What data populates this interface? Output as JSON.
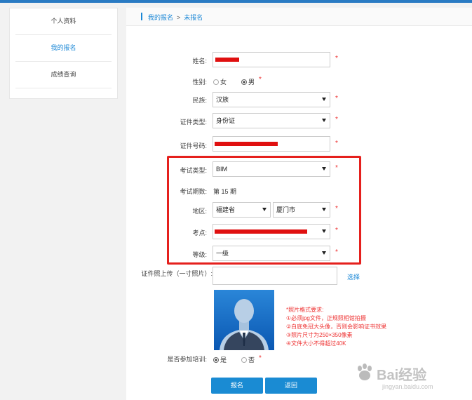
{
  "sidebar": {
    "items": [
      {
        "label": "个人资料"
      },
      {
        "label": "我的报名"
      },
      {
        "label": "成绩查询"
      }
    ]
  },
  "breadcrumb": {
    "parent": "我的报名",
    "separator": ">",
    "current": "未报名"
  },
  "form": {
    "name_label": "姓名:",
    "gender_label": "性别:",
    "gender_female": "女",
    "gender_male": "男",
    "ethnicity_label": "民族:",
    "ethnicity_value": "汉族",
    "id_type_label": "证件类型:",
    "id_type_value": "身份证",
    "id_number_label": "证件号码:",
    "exam_type_label": "考试类型:",
    "exam_type_value": "BIM",
    "exam_period_label": "考试期数:",
    "exam_period_value": "第 15 期",
    "region_label": "地区:",
    "province_value": "福建省",
    "city_value": "厦门市",
    "venue_label": "考点:",
    "level_label": "等级:",
    "level_value": "一级",
    "photo_label": "证件照上传（一寸照片）:",
    "choose_link": "选择",
    "training_label": "是否参加培训:",
    "training_yes": "是",
    "training_no": "否",
    "required_mark": "*"
  },
  "photo_requirements": [
    "*照片格式要求:",
    "①必须jpg文件，正规照相馆拍摄",
    "②白底免冠大头像，否则会影响证书效果",
    "③照片尺寸为250×350像素",
    "④文件大小不得超过40K"
  ],
  "buttons": {
    "submit": "报名",
    "back": "返回"
  },
  "watermark": {
    "brand": "Bai经验",
    "url": "jingyan.baidu.com"
  },
  "colors": {
    "accent": "#1a87d6",
    "highlight": "#e5201d",
    "required": "#e33333"
  }
}
